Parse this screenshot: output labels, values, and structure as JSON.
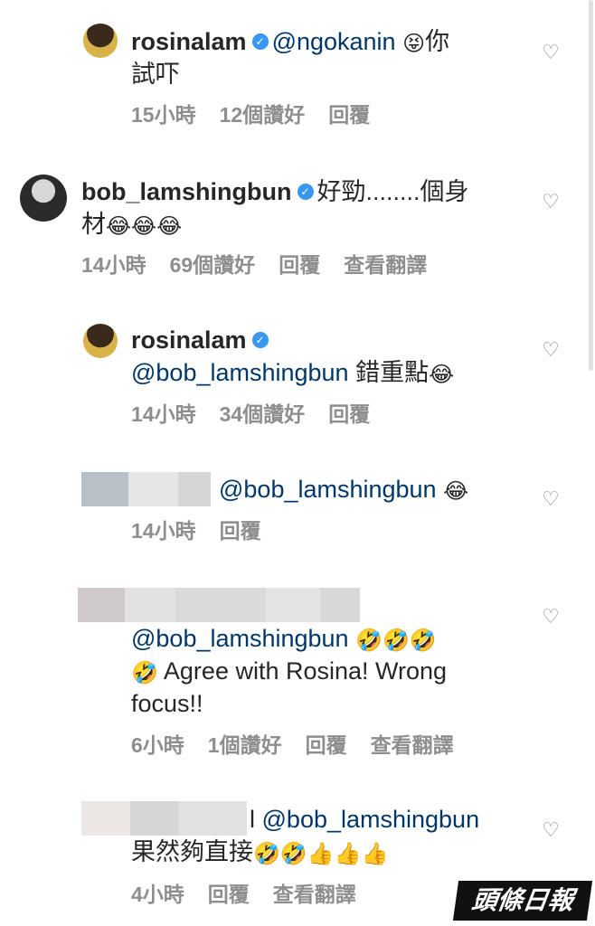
{
  "comments": [
    {
      "username": "rosinalam",
      "mention": "@ngokanin",
      "emoji1": "😝",
      "text1": "你",
      "text2": "試吓",
      "time": "15小時",
      "likes": "12個讚好",
      "reply": "回覆"
    },
    {
      "username": "bob_lamshingbun",
      "text1": "好勁........個身",
      "text2": "材",
      "emojis": "😂😂😂",
      "time": "14小時",
      "likes": "69個讚好",
      "reply": "回覆",
      "translate": "查看翻譯"
    },
    {
      "username": "rosinalam",
      "mention": "@bob_lamshingbun",
      "text": "錯重點",
      "emoji": "😂",
      "time": "14小時",
      "likes": "34個讚好",
      "reply": "回覆"
    },
    {
      "mention": "@bob_lamshingbun",
      "emoji": "😂",
      "time": "14小時",
      "reply": "回覆"
    },
    {
      "mention": "@bob_lamshingbun",
      "emojis": "🤣🤣🤣",
      "emoji2": "🤣",
      "text1": "Agree with Rosina! Wrong",
      "text2": "focus!!",
      "time": "6小時",
      "likes": "1個讚好",
      "reply": "回覆",
      "translate": "查看翻譯"
    },
    {
      "prefix": "l",
      "mention": "@bob_lamshingbun",
      "text": "果然夠直接",
      "emojis": "🤣🤣👍👍👍",
      "time": "4小時",
      "reply": "回覆",
      "translate": "查看翻譯"
    }
  ],
  "icons": {
    "verified": "✓",
    "heart": "♡"
  },
  "watermark": "頭條日報"
}
